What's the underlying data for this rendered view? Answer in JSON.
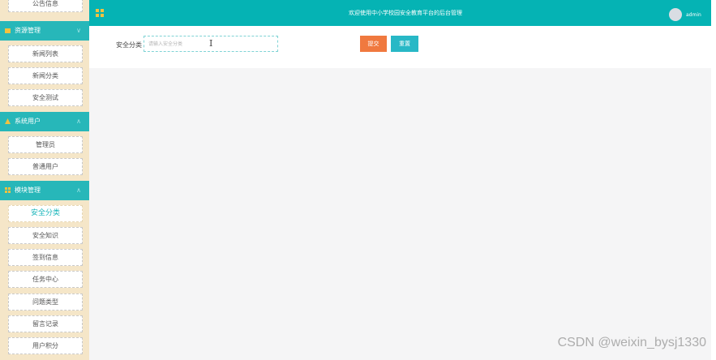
{
  "colors": {
    "primary": "#05b3b4",
    "group_header": "#27b7b9",
    "sidebar_bg": "#f5e6c8",
    "submit": "#f0793f",
    "reset": "#28b8c6"
  },
  "header": {
    "title": "欢迎使用中小学校园安全教育平台的后台管理",
    "username": "admin"
  },
  "sidebar": {
    "top_item": "公告信息",
    "groups": [
      {
        "label": "资源管理",
        "icon": "folder-icon",
        "items": [
          "新闻列表",
          "新闻分类",
          "安全测试"
        ]
      },
      {
        "label": "系统用户",
        "icon": "warning-icon",
        "items": [
          "管理员",
          "普通用户"
        ]
      },
      {
        "label": "模块管理",
        "icon": "grid-icon",
        "items": [
          "安全分类",
          "安全知识",
          "签到信息",
          "任务中心",
          "问题类型",
          "留言记录",
          "用户积分"
        ]
      }
    ]
  },
  "form": {
    "label": "安全分类",
    "input_value": "",
    "placeholder": "请输入安全分类",
    "submit_label": "提交",
    "reset_label": "重置"
  },
  "watermark": "CSDN @weixin_bysj1330"
}
